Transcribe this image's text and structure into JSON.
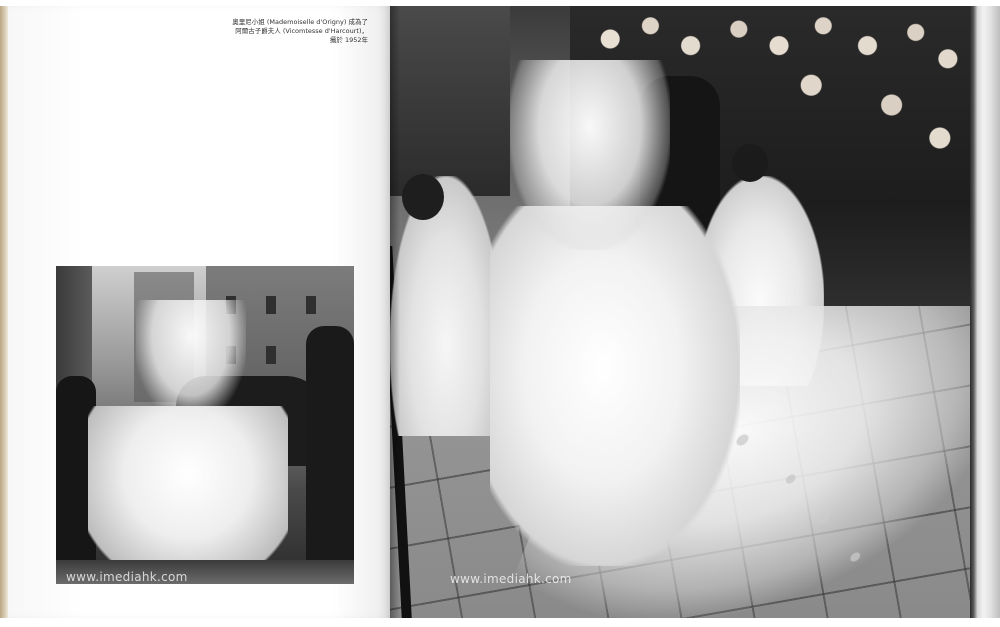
{
  "caption": {
    "line1": "奧里尼小姐 (Mademoiselle d'Origny) 成為了",
    "line2": "阿爾古子爵夫人 (Vicomtesse d'Harcourt)，",
    "line3": "攝於 1952年"
  },
  "watermarks": {
    "left": "www.imediahk.com",
    "right": "www.imediahk.com"
  }
}
